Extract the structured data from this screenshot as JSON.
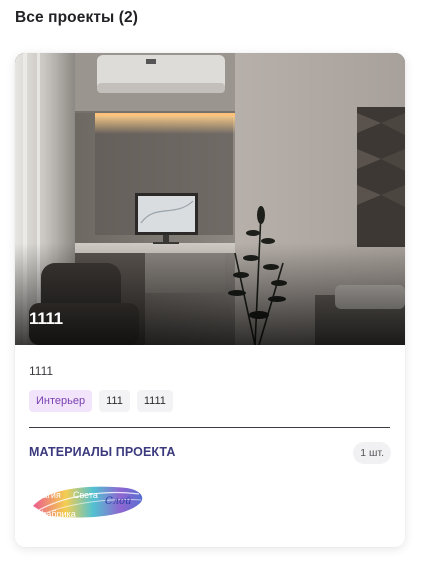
{
  "page": {
    "title": "Все проекты (2)"
  },
  "project_card": {
    "image_title": "1111",
    "name": "1111",
    "tags": [
      "Интерьер",
      "111",
      "1111"
    ],
    "materials": {
      "title": "МАТЕРИАЛЫ ПРОЕКТА",
      "count": "1 шт.",
      "brand_logo": {
        "line1": "Магия",
        "line2": "Света",
        "line3": "фабрика",
        "script": "Слой"
      }
    }
  },
  "colors": {
    "tag_primary_bg": "#f1e4fb",
    "tag_primary_text": "#7a3fb0",
    "materials_title": "#3b3a7e"
  }
}
